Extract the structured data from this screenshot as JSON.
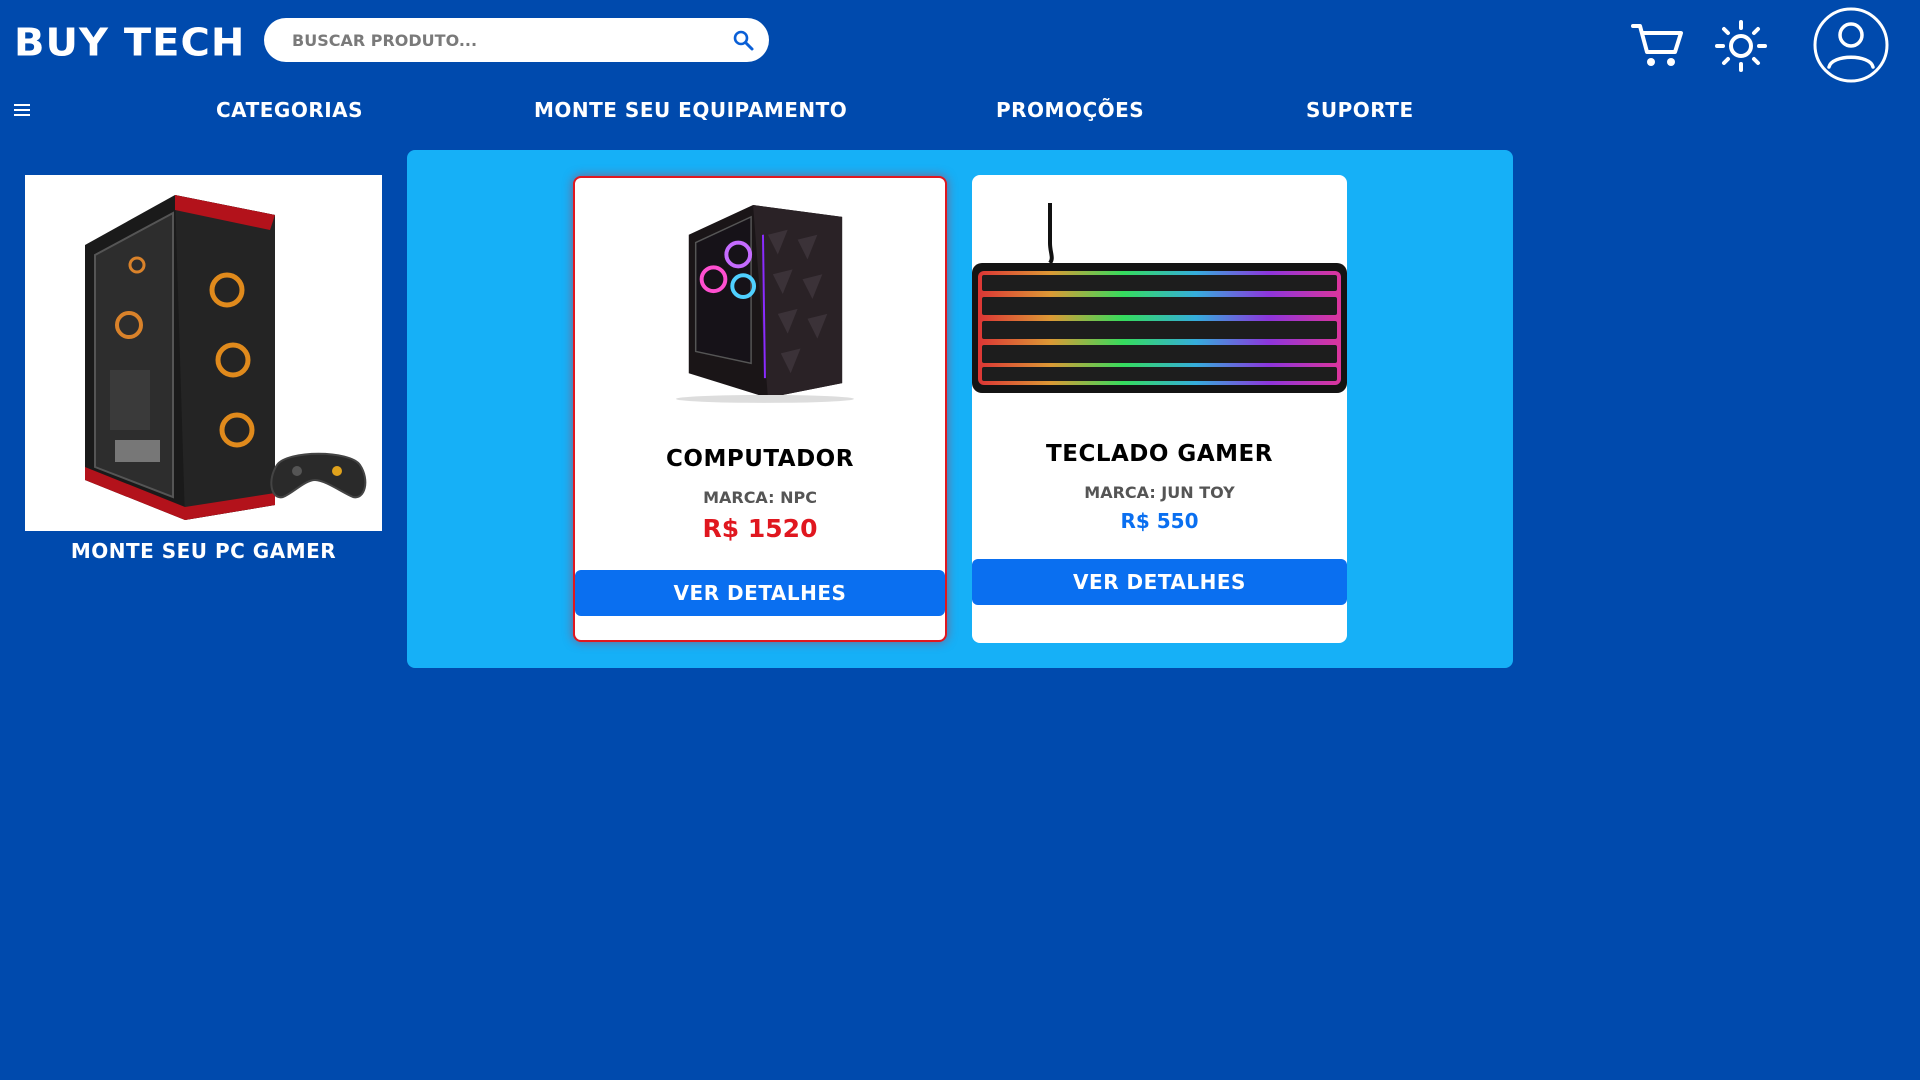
{
  "header": {
    "logo": "BUY TECH",
    "search_placeholder": "BUSCAR PRODUTO..."
  },
  "nav": {
    "links": [
      "CATEGORIAS",
      "MONTE SEU EQUIPAMENTO",
      "PROMOÇÕES",
      "SUPORTE"
    ]
  },
  "promo": {
    "label": "MONTE SEU PC GAMER"
  },
  "products": [
    {
      "title": "COMPUTADOR",
      "brand": "MARCA: NPC",
      "price": "R$ 1520",
      "price_color": "#e0171f",
      "button": "VER DETALHES"
    },
    {
      "title": "TECLADO GAMER",
      "brand": "MARCA: JUN TOY",
      "price": "R$ 550",
      "price_color": "#0a6ff0",
      "button": "VER DETALHES"
    }
  ],
  "colors": {
    "background": "#004aad",
    "panel": "#16b0f7",
    "button": "#0a6ff0",
    "highlight_border": "#e0171f"
  }
}
